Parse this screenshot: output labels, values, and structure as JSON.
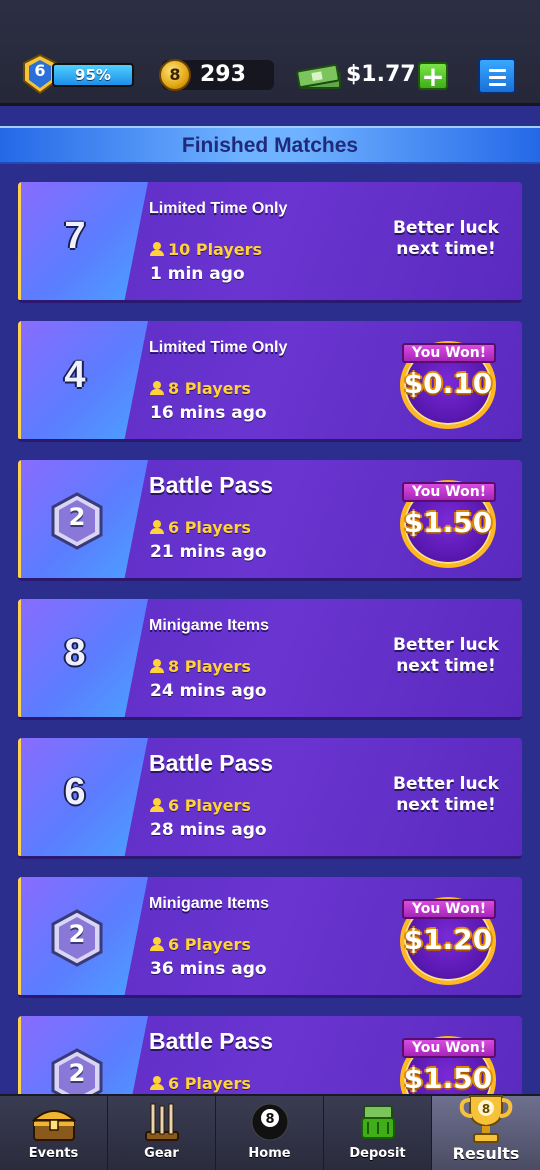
{
  "topbar": {
    "level": "6",
    "xp_percent_label": "95%",
    "coin_icon_label": "8",
    "coins": "293",
    "cash": "$1.77",
    "plus_label": "+"
  },
  "header": {
    "title": "Finished Matches"
  },
  "matches": [
    {
      "rank": "7",
      "rank_style": "number",
      "title": "Limited Time Only",
      "players": "10 Players",
      "time": "1 min ago",
      "result": "lose",
      "result_line1": "Better luck",
      "result_line2": "next time!"
    },
    {
      "rank": "4",
      "rank_style": "number",
      "title": "Limited Time Only",
      "players": "8 Players",
      "time": "16 mins ago",
      "result": "win",
      "ribbon": "You Won!",
      "amount": "$0.10"
    },
    {
      "rank": "2",
      "rank_style": "hex",
      "title": "Battle Pass",
      "players": "6 Players",
      "time": "21 mins ago",
      "result": "win",
      "ribbon": "You Won!",
      "amount": "$1.50"
    },
    {
      "rank": "8",
      "rank_style": "number",
      "title": "Minigame Items",
      "players": "8 Players",
      "time": "24 mins ago",
      "result": "lose",
      "result_line1": "Better luck",
      "result_line2": "next time!"
    },
    {
      "rank": "6",
      "rank_style": "number",
      "title": "Battle Pass",
      "players": "6 Players",
      "time": "28 mins ago",
      "result": "lose",
      "result_line1": "Better luck",
      "result_line2": "next time!"
    },
    {
      "rank": "2",
      "rank_style": "hex",
      "title": "Minigame Items",
      "players": "6 Players",
      "time": "36 mins ago",
      "result": "win",
      "ribbon": "You Won!",
      "amount": "$1.20"
    },
    {
      "rank": "2",
      "rank_style": "hex",
      "title": "Battle Pass",
      "players": "6 Players",
      "time": "",
      "result": "win",
      "ribbon": "You Won!",
      "amount": "$1.50"
    }
  ],
  "nav": {
    "items": [
      {
        "label": "Events",
        "icon": "treasure-chest-icon"
      },
      {
        "label": "Gear",
        "icon": "cue-rack-icon"
      },
      {
        "label": "Home",
        "icon": "eight-ball-icon"
      },
      {
        "label": "Deposit",
        "icon": "cash-basket-icon"
      },
      {
        "label": "Results",
        "icon": "trophy-icon"
      }
    ],
    "home_ball_label": "8",
    "trophy_label": "8",
    "active": "Results"
  },
  "colors": {
    "background": "#2b2e8c",
    "card": "#5b2cc4",
    "accent_gold": "#ffd23a",
    "header_blue": "#6fb2ff"
  }
}
